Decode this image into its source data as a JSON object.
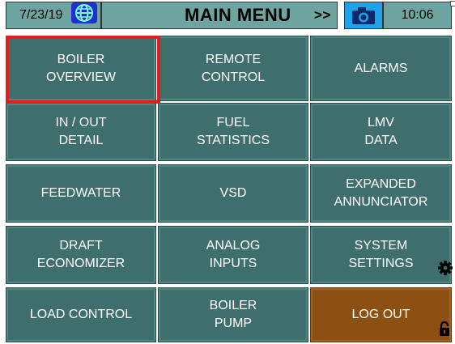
{
  "header": {
    "date": "7/23/19",
    "title": "MAIN MENU",
    "next_label": ">>",
    "time": "10:06",
    "globe_icon": "globe-icon",
    "camera_icon": "camera-icon"
  },
  "menu": {
    "rows": [
      [
        "BOILER\nOVERVIEW",
        "REMOTE\nCONTROL",
        "ALARMS"
      ],
      [
        "IN / OUT\nDETAIL",
        "FUEL\nSTATISTICS",
        "LMV\nDATA"
      ],
      [
        "FEEDWATER",
        "VSD",
        "EXPANDED\nANNUNCIATOR"
      ],
      [
        "DRAFT\nECONOMIZER",
        "ANALOG\nINPUTS",
        "SYSTEM\nSETTINGS"
      ],
      [
        "LOAD CONTROL",
        "BOILER\nPUMP",
        "LOG OUT"
      ]
    ],
    "selected": "BOILER\nOVERVIEW"
  },
  "icons": {
    "settings": "gear-icon",
    "unlock": "unlock-icon"
  },
  "colors": {
    "button": "#3f6f6c",
    "header": "#6fa5a0",
    "logout": "#8c5012",
    "selection": "#e01e1e",
    "globe": "#1f2fd1",
    "camera": "#1ea3e8"
  }
}
